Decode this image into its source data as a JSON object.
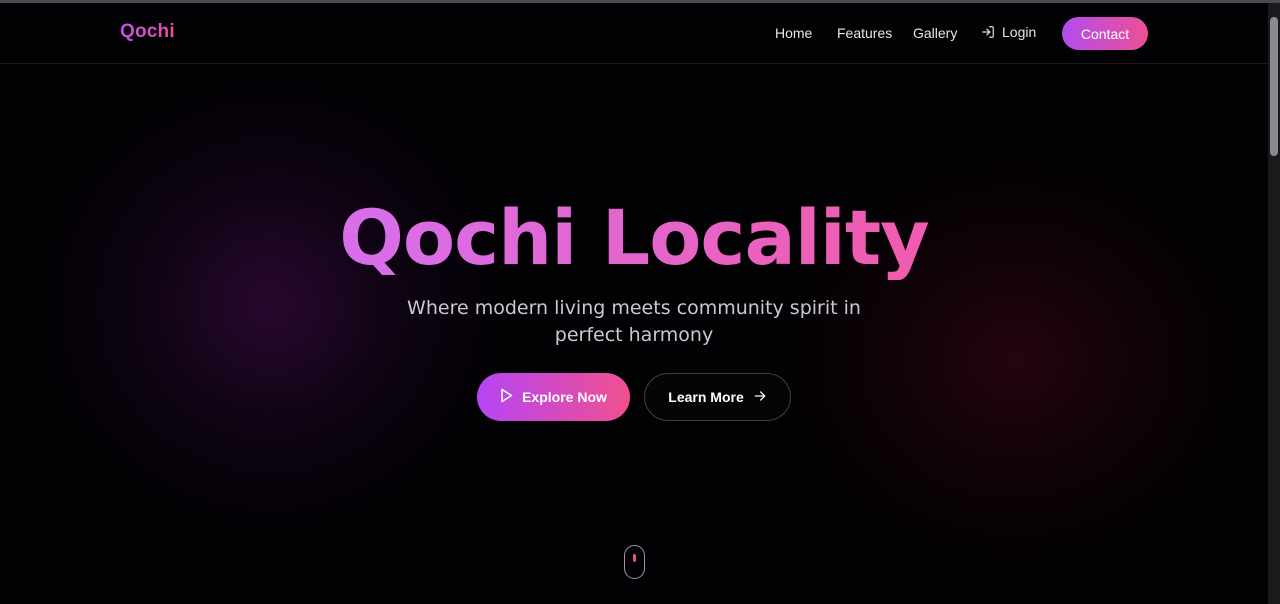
{
  "brand": {
    "logo": "Qochi"
  },
  "nav": {
    "home": "Home",
    "features": "Features",
    "gallery": "Gallery",
    "login": "Login",
    "contact": "Contact"
  },
  "hero": {
    "title": "Qochi Locality",
    "subtitle": "Where modern living meets community spirit in perfect harmony",
    "explore_label": "Explore Now",
    "learn_label": "Learn More"
  },
  "icons": {
    "login": "login-icon",
    "play": "play-icon",
    "arrow": "arrow-right-icon",
    "scroll": "mouse-scroll-icon"
  },
  "colors": {
    "accent_purple": "#b545f5",
    "accent_pink": "#f0508f",
    "background": "#020103"
  }
}
